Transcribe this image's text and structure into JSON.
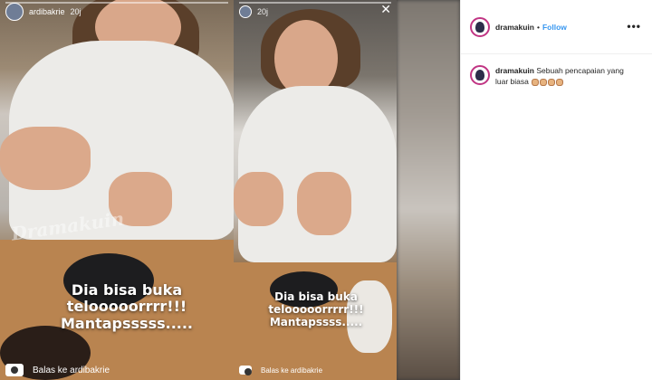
{
  "story_left": {
    "username": "ardibakrie",
    "time": "20j",
    "watermark": "Dramakuin",
    "text_lines": [
      "Dia bisa buka",
      "telooooorrrr!!!",
      "Mantapsssss....."
    ],
    "reply_label": "Balas ke ardibakrie"
  },
  "story_mid": {
    "username": "",
    "time": "20j",
    "close_icon": "close-icon",
    "text_lines": [
      "Dia bisa buka",
      "telooooorrrrr!!!",
      "Mantapssss....."
    ],
    "reply_label": "Balas ke ardibakrie"
  },
  "post": {
    "username": "dramakuin",
    "separator": "•",
    "follow_label": "Follow",
    "more_label": "•••",
    "caption_user": "dramakuin",
    "caption_text": "Sebuah pencapaian yang luar biasa",
    "caption_emoji": "clapping-hands-emoji"
  },
  "colors": {
    "follow": "#3897f0",
    "text": "#262626",
    "avatar_ring": "#c13584"
  }
}
